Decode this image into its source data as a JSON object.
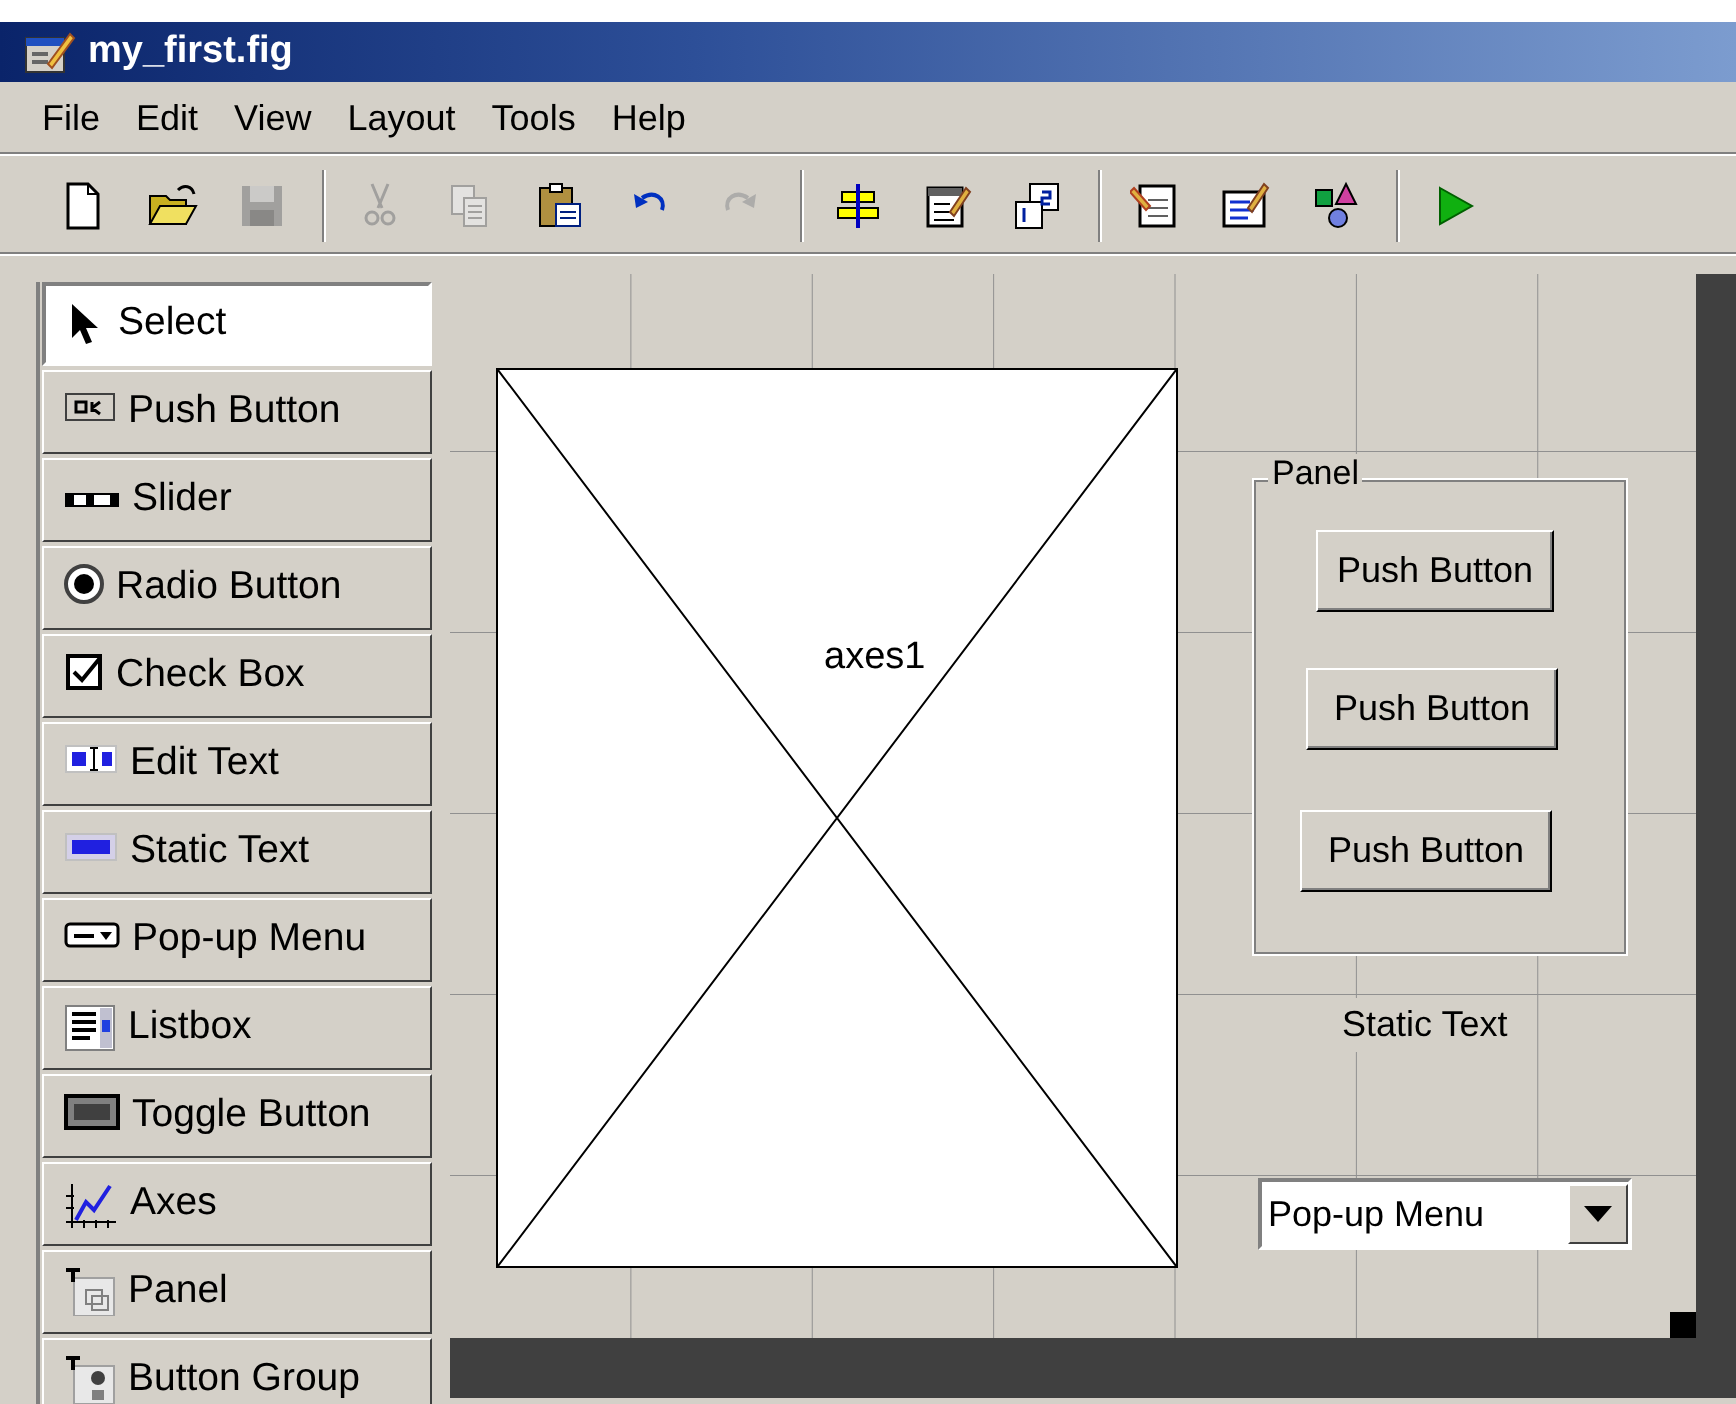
{
  "window": {
    "title": "my_first.fig"
  },
  "menu": [
    {
      "label": "File"
    },
    {
      "label": "Edit"
    },
    {
      "label": "View"
    },
    {
      "label": "Layout"
    },
    {
      "label": "Tools"
    },
    {
      "label": "Help"
    }
  ],
  "toolbar": [
    [
      {
        "kind": "new",
        "disabled": false
      },
      {
        "kind": "open",
        "disabled": false
      },
      {
        "kind": "save",
        "disabled": true
      }
    ],
    [
      {
        "kind": "cut",
        "disabled": true
      },
      {
        "kind": "copy",
        "disabled": true
      },
      {
        "kind": "paste",
        "disabled": false
      },
      {
        "kind": "undo",
        "disabled": false
      },
      {
        "kind": "redo",
        "disabled": true
      }
    ],
    [
      {
        "kind": "align",
        "disabled": false
      },
      {
        "kind": "menueditor",
        "disabled": false
      },
      {
        "kind": "taborder",
        "disabled": false
      }
    ],
    [
      {
        "kind": "editor",
        "disabled": false
      },
      {
        "kind": "inspector",
        "disabled": false
      },
      {
        "kind": "browser",
        "disabled": false
      }
    ],
    [
      {
        "kind": "run",
        "disabled": false
      }
    ]
  ],
  "palette": [
    {
      "kind": "select",
      "label": "Select",
      "selected": true
    },
    {
      "kind": "pushbutton",
      "label": "Push Button",
      "selected": false
    },
    {
      "kind": "slider",
      "label": "Slider",
      "selected": false
    },
    {
      "kind": "radio",
      "label": "Radio Button",
      "selected": false
    },
    {
      "kind": "checkbox",
      "label": "Check Box",
      "selected": false
    },
    {
      "kind": "edit",
      "label": "Edit Text",
      "selected": false
    },
    {
      "kind": "text",
      "label": "Static Text",
      "selected": false
    },
    {
      "kind": "popup",
      "label": "Pop-up Menu",
      "selected": false
    },
    {
      "kind": "listbox",
      "label": "Listbox",
      "selected": false
    },
    {
      "kind": "toggle",
      "label": "Toggle Button",
      "selected": false
    },
    {
      "kind": "axes",
      "label": "Axes",
      "selected": false
    },
    {
      "kind": "panel",
      "label": "Panel",
      "selected": false
    },
    {
      "kind": "buttongroup",
      "label": "Button Group",
      "selected": false
    }
  ],
  "canvas": {
    "axes": {
      "label": "axes1"
    },
    "panel": {
      "title": "Panel",
      "buttons": [
        {
          "label": "Push Button"
        },
        {
          "label": "Push Button"
        },
        {
          "label": "Push Button"
        }
      ]
    },
    "static_text": "Static Text",
    "popup": {
      "value": "Pop-up Menu"
    }
  }
}
